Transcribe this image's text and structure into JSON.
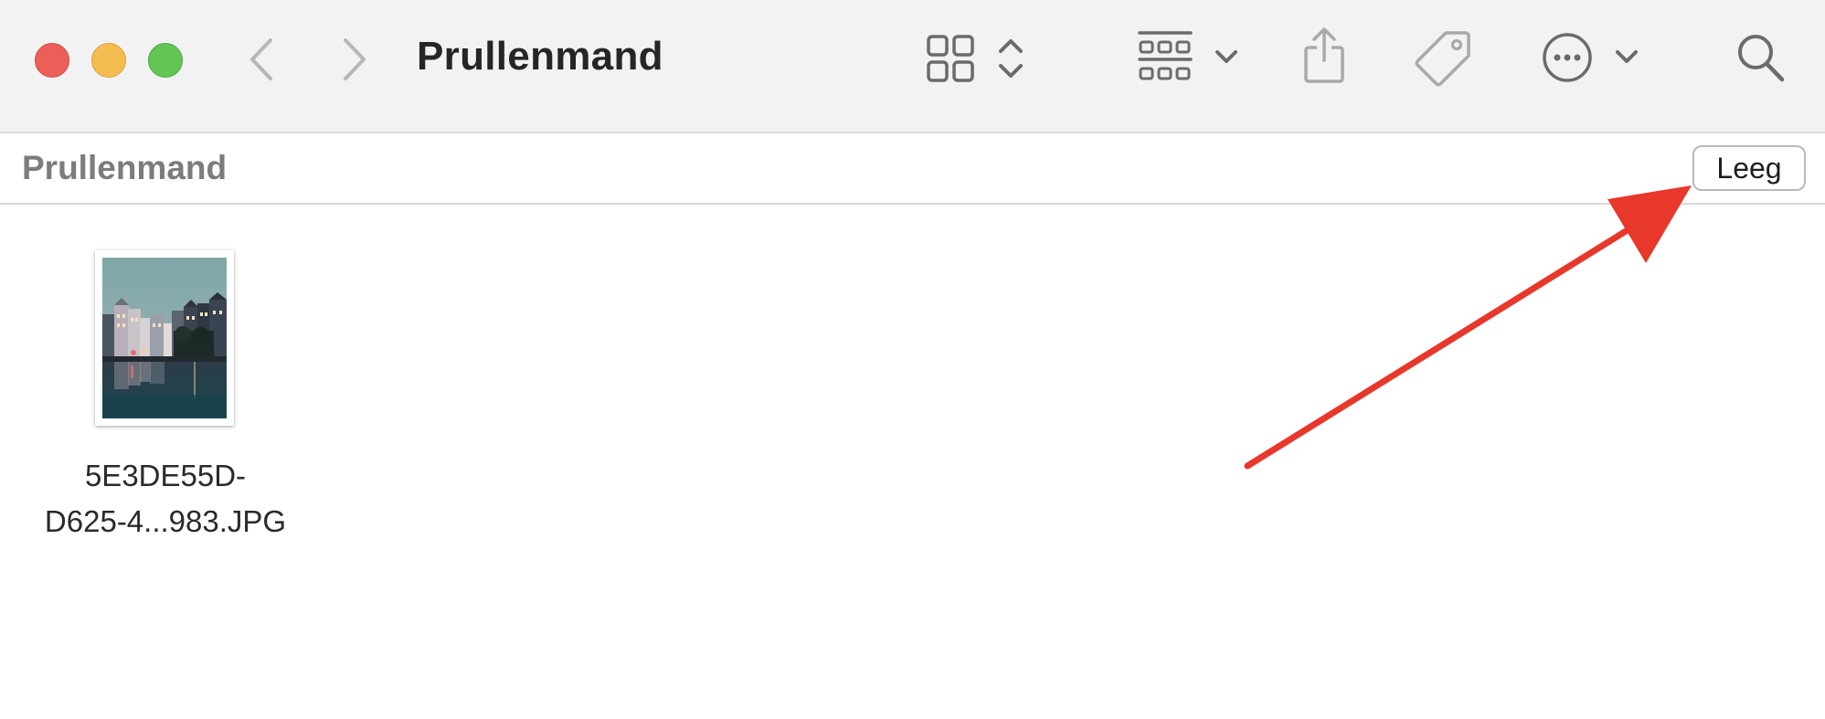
{
  "window": {
    "title": "Prullenmand"
  },
  "toolbar": {
    "icons": [
      "close-window",
      "minimize-window",
      "maximize-window",
      "back-chevron-icon",
      "forward-chevron-icon",
      "icon-view-grid-icon",
      "view-switch-updown-icon",
      "group-by-icon",
      "chevron-down-icon",
      "share-icon",
      "tag-icon",
      "more-actions-icon",
      "chevron-down-icon",
      "search-icon"
    ]
  },
  "pathbar": {
    "title": "Prullenmand",
    "empty_button_label": "Leeg"
  },
  "files": [
    {
      "name_line1": "5E3DE55D-",
      "name_line2": "D625-4...983.JPG",
      "thumbnail": "canal-houses-photo"
    }
  ],
  "colors": {
    "toolbar_bg": "#f2f2f3",
    "close": "#ec5f58",
    "minimize": "#f4bd4f",
    "maximize": "#62c554",
    "annotation_arrow": "#e8372b"
  }
}
